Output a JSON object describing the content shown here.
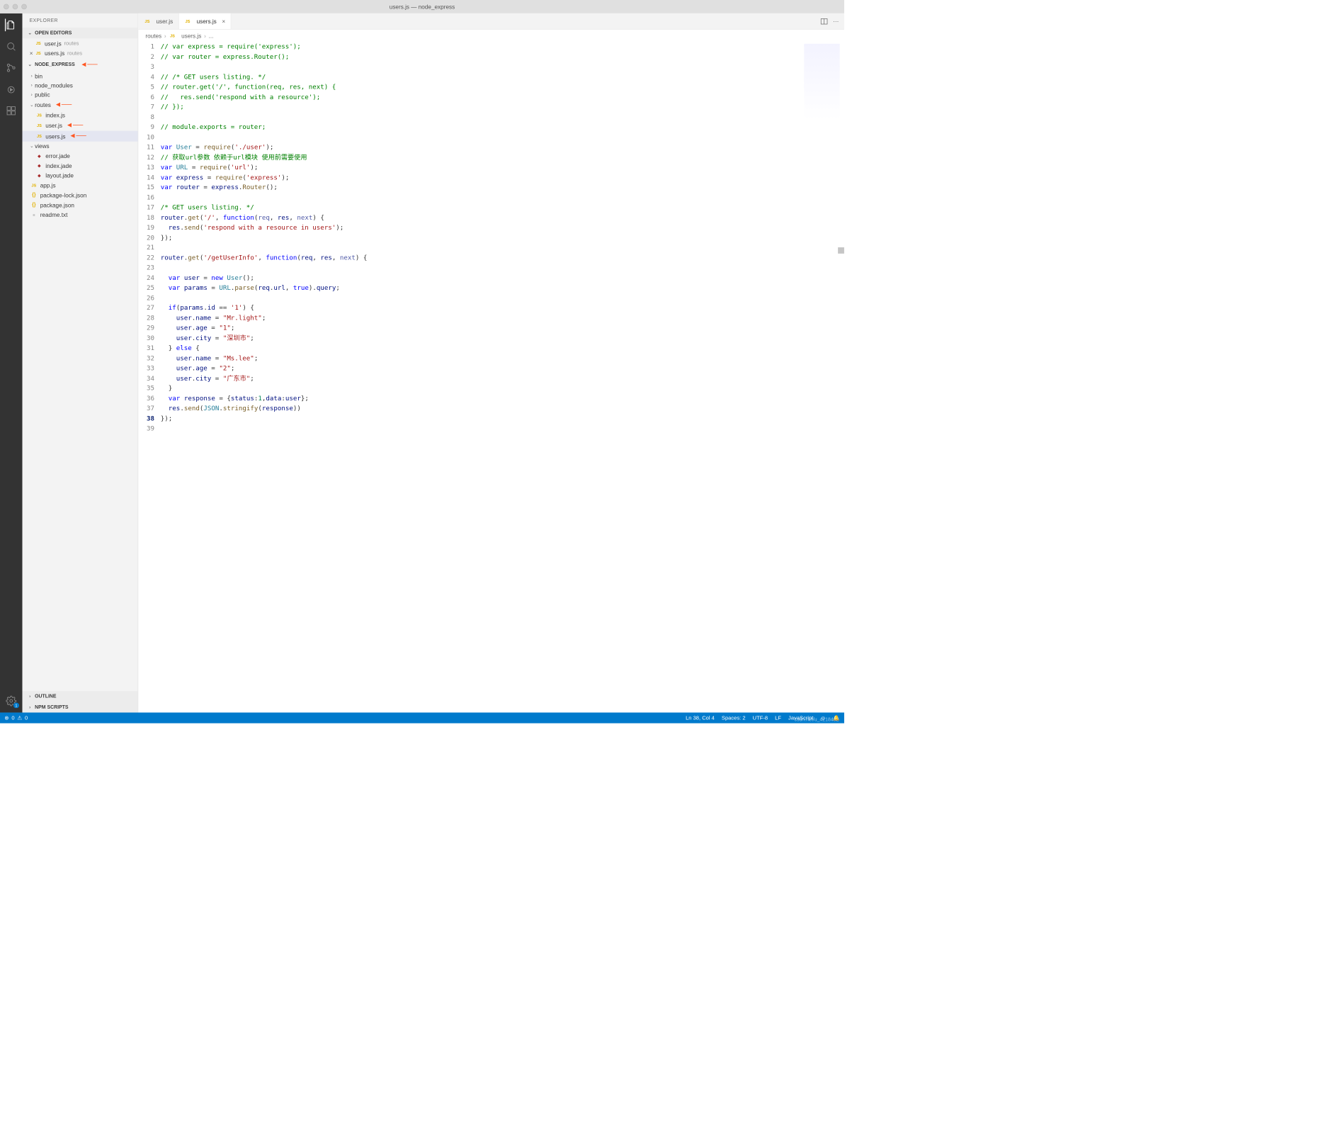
{
  "window_title": "users.js — node_express",
  "sidebar": {
    "title": "EXPLORER",
    "sections": {
      "open_editors": "OPEN EDITORS",
      "project": "NODE_EXPRESS",
      "outline": "OUTLINE",
      "npm_scripts": "NPM SCRIPTS"
    },
    "open_editors": [
      {
        "icon": "JS",
        "name": "user.js",
        "dir": "routes",
        "close": false
      },
      {
        "icon": "JS",
        "name": "users.js",
        "dir": "routes",
        "close": true
      }
    ],
    "tree": {
      "bin": "bin",
      "node_modules": "node_modules",
      "public": "public",
      "routes": "routes",
      "routes_children": [
        {
          "icon": "JS",
          "name": "index.js"
        },
        {
          "icon": "JS",
          "name": "user.js",
          "arrow": true
        },
        {
          "icon": "JS",
          "name": "users.js",
          "arrow": true,
          "active": true
        }
      ],
      "views": "views",
      "views_children": [
        {
          "icon": "jade",
          "name": "error.jade"
        },
        {
          "icon": "jade",
          "name": "index.jade"
        },
        {
          "icon": "jade",
          "name": "layout.jade"
        }
      ],
      "root_files": [
        {
          "icon": "JS",
          "name": "app.js"
        },
        {
          "icon": "{}",
          "name": "package-lock.json"
        },
        {
          "icon": "{}",
          "name": "package.json"
        },
        {
          "icon": "≡",
          "name": "readme.txt"
        }
      ]
    }
  },
  "activity": {
    "settings_badge": "1"
  },
  "tabs": [
    {
      "icon": "JS",
      "label": "user.js",
      "active": false
    },
    {
      "icon": "JS",
      "label": "users.js",
      "active": true,
      "close": true
    }
  ],
  "breadcrumb": {
    "routes": "routes",
    "file": "users.js",
    "more": "..."
  },
  "code": {
    "lines": [
      {
        "n": 1,
        "html": "<span class='tok-cm'>// var express = require('express');</span>"
      },
      {
        "n": 2,
        "html": "<span class='tok-cm'>// var router = express.Router();</span>"
      },
      {
        "n": 3,
        "html": ""
      },
      {
        "n": 4,
        "html": "<span class='tok-cm'>// /* GET users listing. */</span>"
      },
      {
        "n": 5,
        "html": "<span class='tok-cm'>// router.get('/', function(req, res, next) {</span>"
      },
      {
        "n": 6,
        "html": "<span class='tok-cm'>//   res.send('respond with a resource');</span>"
      },
      {
        "n": 7,
        "html": "<span class='tok-cm'>// });</span>"
      },
      {
        "n": 8,
        "html": ""
      },
      {
        "n": 9,
        "html": "<span class='tok-cm'>// module.exports = router;</span>"
      },
      {
        "n": 10,
        "html": ""
      },
      {
        "n": 11,
        "html": "<span class='tok-kw'>var</span> <span class='tok-ty'>User</span> = <span class='tok-fn'>require</span>(<span class='tok-st'>'./user'</span>);"
      },
      {
        "n": 12,
        "html": "<span class='tok-cm'>// 获取url参数 依赖于url模块 使用前需要使用</span>"
      },
      {
        "n": 13,
        "html": "<span class='tok-kw'>var</span> <span class='tok-ty'>URL</span> = <span class='tok-fn'>require</span>(<span class='tok-st'>'url'</span>);"
      },
      {
        "n": 14,
        "html": "<span class='tok-kw'>var</span> <span class='tok-vr'>express</span> = <span class='tok-fn'>require</span>(<span class='tok-st'>'express'</span>);"
      },
      {
        "n": 15,
        "html": "<span class='tok-kw'>var</span> <span class='tok-vr'>router</span> = <span class='tok-vr'>express</span>.<span class='tok-fn'>Router</span>();"
      },
      {
        "n": 16,
        "html": ""
      },
      {
        "n": 17,
        "html": "<span class='tok-cm'>/* GET users listing. */</span>"
      },
      {
        "n": 18,
        "html": "<span class='tok-vr'>router</span>.<span class='tok-fn'>get</span>(<span class='tok-st'>'/'</span>, <span class='tok-kw'>function</span>(<span class='tok-pr'>req</span>, <span class='tok-vr'>res</span>, <span class='tok-pr'>next</span>) {"
      },
      {
        "n": 19,
        "html": "  <span class='tok-vr'>res</span>.<span class='tok-fn'>send</span>(<span class='tok-st'>'respond with a resource in users'</span>);"
      },
      {
        "n": 20,
        "html": "});"
      },
      {
        "n": 21,
        "html": ""
      },
      {
        "n": 22,
        "html": "<span class='tok-vr'>router</span>.<span class='tok-fn'>get</span>(<span class='tok-st'>'/getUserInfo'</span>, <span class='tok-kw'>function</span>(<span class='tok-vr'>req</span>, <span class='tok-vr'>res</span>, <span class='tok-pr'>next</span>) {"
      },
      {
        "n": 23,
        "html": ""
      },
      {
        "n": 24,
        "html": "  <span class='tok-kw'>var</span> <span class='tok-vr'>user</span> = <span class='tok-kw'>new</span> <span class='tok-ty'>User</span>();"
      },
      {
        "n": 25,
        "html": "  <span class='tok-kw'>var</span> <span class='tok-vr'>params</span> = <span class='tok-ty'>URL</span>.<span class='tok-fn'>parse</span>(<span class='tok-vr'>req</span>.<span class='tok-vr'>url</span>, <span class='tok-kw'>true</span>).<span class='tok-vr'>query</span>;"
      },
      {
        "n": 26,
        "html": ""
      },
      {
        "n": 27,
        "html": "  <span class='tok-kw'>if</span>(<span class='tok-vr'>params</span>.<span class='tok-vr'>id</span> == <span class='tok-st'>'1'</span>) {"
      },
      {
        "n": 28,
        "html": "    <span class='tok-vr'>user</span>.<span class='tok-vr'>name</span> = <span class='tok-st'>\"Mr.light\"</span>;"
      },
      {
        "n": 29,
        "html": "    <span class='tok-vr'>user</span>.<span class='tok-vr'>age</span> = <span class='tok-st'>\"1\"</span>;"
      },
      {
        "n": 30,
        "html": "    <span class='tok-vr'>user</span>.<span class='tok-vr'>city</span> = <span class='tok-st'>\"深圳市\"</span>;"
      },
      {
        "n": 31,
        "html": "  } <span class='tok-kw'>else</span> {"
      },
      {
        "n": 32,
        "html": "    <span class='tok-vr'>user</span>.<span class='tok-vr'>name</span> = <span class='tok-st'>\"Ms.lee\"</span>;"
      },
      {
        "n": 33,
        "html": "    <span class='tok-vr'>user</span>.<span class='tok-vr'>age</span> = <span class='tok-st'>\"2\"</span>;"
      },
      {
        "n": 34,
        "html": "    <span class='tok-vr'>user</span>.<span class='tok-vr'>city</span> = <span class='tok-st'>\"广东市\"</span>;"
      },
      {
        "n": 35,
        "html": "  }"
      },
      {
        "n": 36,
        "html": "  <span class='tok-kw'>var</span> <span class='tok-vr'>response</span> = {<span class='tok-vr'>status</span>:<span class='tok-nm'>1</span>,<span class='tok-vr'>data</span>:<span class='tok-vr'>user</span>};"
      },
      {
        "n": 37,
        "html": "  <span class='tok-vr'>res</span>.<span class='tok-fn'>send</span>(<span class='tok-ty'>JSON</span>.<span class='tok-fn'>stringify</span>(<span class='tok-vr'>response</span>))"
      },
      {
        "n": 38,
        "html": "});",
        "cur": true
      },
      {
        "n": 39,
        "html": ""
      }
    ]
  },
  "status": {
    "errors": "0",
    "warnings": "0",
    "cursor": "Ln 38, Col 4",
    "spaces": "Spaces: 2",
    "encoding": "UTF-8",
    "eol": "LF",
    "lang": "JavaScript"
  },
  "watermark": "csdn.net/u_4218492"
}
